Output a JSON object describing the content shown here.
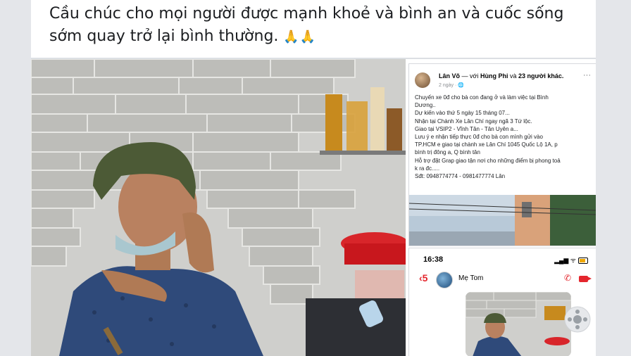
{
  "post": {
    "text_line1": "Cầu chúc cho mọi người được mạnh khoẻ và bình an và cuốc sống",
    "text_line2": "sớm quay trở lại bình thường.",
    "emoji": "🙏🙏"
  },
  "fb_screenshot": {
    "author": "Lân Võ",
    "with_text": "— với",
    "tagged_name": "Hùng Phi",
    "and_text": "và",
    "others": "23 người khác.",
    "time": "2 ngày · 🌐",
    "more": "···",
    "lines": [
      "Chuyến xe 0đ cho bà con đang ở và làm việc tại Bình",
      "Dương..",
      "Dự kiến vào thứ 5 ngày 15 tháng 07...",
      "Nhận tại Chành Xe Lân Chí ngay ngã 3 Tứ lộc.",
      "Giao tại VSIP2 - Vĩnh Tân - Tân Uyên a...",
      "Lưu ý e nhận tiếp thực 0đ cho bà con mình gửi vào",
      "TP.HCM e giao tại chành xe Lân Chí 1045 Quốc Lộ 1A, p",
      "bình trị đông a, Q bình tân",
      "Hỗ trợ đặt Grap giao tận nơi cho những điểm bị phong toả",
      "k ra đc.....",
      "Sđt: 0948774774 - 0981477774 Lân"
    ]
  },
  "phone": {
    "time": "16:38",
    "status": "▂▄▆ ᯤ",
    "back": "‹5",
    "contact": "Mẹ Tom"
  },
  "colors": {
    "messenger_red": "#e4262d",
    "text": "#1c1e21",
    "muted": "#8a8d91"
  }
}
